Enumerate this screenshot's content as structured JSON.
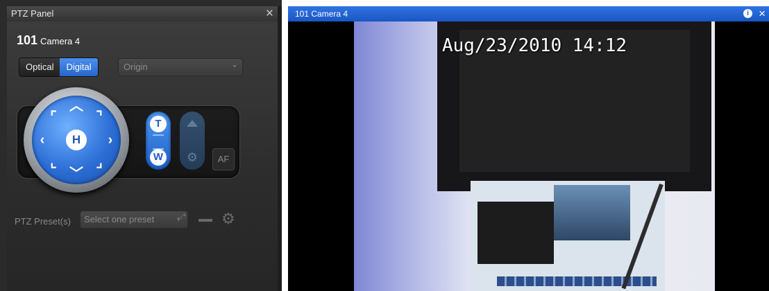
{
  "ptz_panel": {
    "title": "PTZ Panel",
    "close_icon": "×",
    "camera_number": "101",
    "camera_name": "Camera 4",
    "mode_tabs": [
      {
        "label": "Optical",
        "selected": false
      },
      {
        "label": "Digital",
        "selected": true
      }
    ],
    "origin_select": {
      "value": "Origin"
    },
    "joystick": {
      "home_label": "H"
    },
    "zoom": {
      "tele_label": "T",
      "wide_label": "W"
    },
    "af_label": "AF",
    "presets": {
      "label": "PTZ Preset(s)",
      "placeholder": "Select one preset",
      "add_icon": "⤶⁺",
      "remove_icon": "—",
      "settings_icon": "⚙"
    }
  },
  "camera_view": {
    "title": "101  Camera 4",
    "info_icon": "i",
    "close_icon": "×",
    "timestamp": "Aug/23/2010 14:12"
  }
}
